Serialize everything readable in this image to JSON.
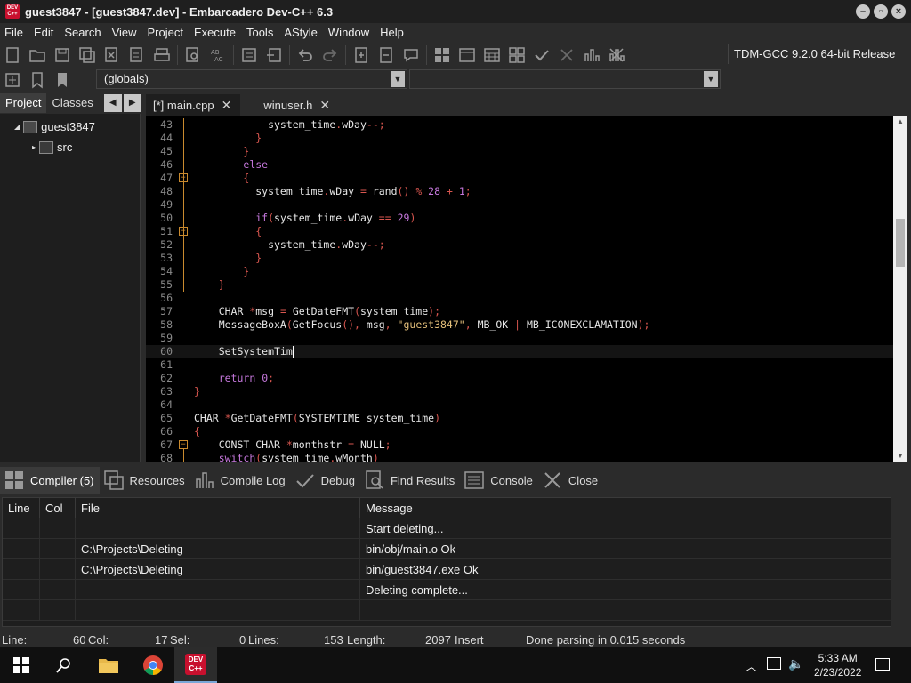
{
  "window": {
    "title": "guest3847 - [guest3847.dev] - Embarcadero Dev-C++ 6.3",
    "icon_label": "DEV C++"
  },
  "menu": [
    "File",
    "Edit",
    "Search",
    "View",
    "Project",
    "Execute",
    "Tools",
    "AStyle",
    "Window",
    "Help"
  ],
  "toolbar": {
    "compiler": "TDM-GCC 9.2.0 64-bit Release",
    "scope_selector": "(globals)",
    "function_selector": ""
  },
  "left_panel": {
    "tabs": [
      "Project",
      "Classes"
    ],
    "tree": [
      {
        "label": "guest3847"
      },
      {
        "label": "src"
      }
    ]
  },
  "editor": {
    "tabs": [
      {
        "label": "[*] main.cpp"
      },
      {
        "label": "winuser.h"
      }
    ],
    "line_numbers": [
      "43",
      "44",
      "45",
      "46",
      "47",
      "48",
      "49",
      "50",
      "51",
      "52",
      "53",
      "54",
      "55",
      "56",
      "57",
      "58",
      "59",
      "60",
      "61",
      "62",
      "63",
      "64",
      "65",
      "66",
      "67",
      "68"
    ],
    "lines": [
      [
        {
          "t": "            system_time",
          "c": "plain"
        },
        {
          "t": ".",
          "c": "op"
        },
        {
          "t": "wDay",
          "c": "plain"
        },
        {
          "t": "--;",
          "c": "op"
        }
      ],
      [
        {
          "t": "          ",
          "c": "plain"
        },
        {
          "t": "}",
          "c": "op"
        }
      ],
      [
        {
          "t": "        ",
          "c": "plain"
        },
        {
          "t": "}",
          "c": "op"
        }
      ],
      [
        {
          "t": "        ",
          "c": "plain"
        },
        {
          "t": "else",
          "c": "kw"
        }
      ],
      [
        {
          "t": "        ",
          "c": "plain"
        },
        {
          "t": "{",
          "c": "op"
        }
      ],
      [
        {
          "t": "          system_time",
          "c": "plain"
        },
        {
          "t": ".",
          "c": "op"
        },
        {
          "t": "wDay ",
          "c": "plain"
        },
        {
          "t": "=",
          "c": "op"
        },
        {
          "t": " rand",
          "c": "plain"
        },
        {
          "t": "()",
          "c": "op"
        },
        {
          "t": " % ",
          "c": "op"
        },
        {
          "t": "28",
          "c": "num"
        },
        {
          "t": " + ",
          "c": "op"
        },
        {
          "t": "1",
          "c": "num"
        },
        {
          "t": ";",
          "c": "op"
        }
      ],
      [
        {
          "t": "",
          "c": "plain"
        }
      ],
      [
        {
          "t": "          ",
          "c": "plain"
        },
        {
          "t": "if",
          "c": "kw"
        },
        {
          "t": "(",
          "c": "op"
        },
        {
          "t": "system_time",
          "c": "plain"
        },
        {
          "t": ".",
          "c": "op"
        },
        {
          "t": "wDay ",
          "c": "plain"
        },
        {
          "t": "==",
          "c": "op"
        },
        {
          "t": " ",
          "c": "plain"
        },
        {
          "t": "29",
          "c": "num"
        },
        {
          "t": ")",
          "c": "op"
        }
      ],
      [
        {
          "t": "          ",
          "c": "plain"
        },
        {
          "t": "{",
          "c": "op"
        }
      ],
      [
        {
          "t": "            system_time",
          "c": "plain"
        },
        {
          "t": ".",
          "c": "op"
        },
        {
          "t": "wDay",
          "c": "plain"
        },
        {
          "t": "--;",
          "c": "op"
        }
      ],
      [
        {
          "t": "          ",
          "c": "plain"
        },
        {
          "t": "}",
          "c": "op"
        }
      ],
      [
        {
          "t": "        ",
          "c": "plain"
        },
        {
          "t": "}",
          "c": "op"
        }
      ],
      [
        {
          "t": "    ",
          "c": "plain"
        },
        {
          "t": "}",
          "c": "op"
        }
      ],
      [
        {
          "t": "",
          "c": "plain"
        }
      ],
      [
        {
          "t": "    CHAR ",
          "c": "plain"
        },
        {
          "t": "*",
          "c": "op"
        },
        {
          "t": "msg ",
          "c": "plain"
        },
        {
          "t": "=",
          "c": "op"
        },
        {
          "t": " GetDateFMT",
          "c": "plain"
        },
        {
          "t": "(",
          "c": "op"
        },
        {
          "t": "system_time",
          "c": "plain"
        },
        {
          "t": ");",
          "c": "op"
        }
      ],
      [
        {
          "t": "    MessageBoxA",
          "c": "plain"
        },
        {
          "t": "(",
          "c": "op"
        },
        {
          "t": "GetFocus",
          "c": "plain"
        },
        {
          "t": "(),",
          "c": "op"
        },
        {
          "t": " msg",
          "c": "plain"
        },
        {
          "t": ",",
          "c": "op"
        },
        {
          "t": " ",
          "c": "plain"
        },
        {
          "t": "\"guest3847\"",
          "c": "str"
        },
        {
          "t": ",",
          "c": "op"
        },
        {
          "t": " MB_OK ",
          "c": "plain"
        },
        {
          "t": "|",
          "c": "op"
        },
        {
          "t": " MB_ICONEXCLAMATION",
          "c": "plain"
        },
        {
          "t": ");",
          "c": "op"
        }
      ],
      [
        {
          "t": "",
          "c": "plain"
        }
      ],
      [
        {
          "t": "    SetSystemTim",
          "c": "plain"
        }
      ],
      [
        {
          "t": "",
          "c": "plain"
        }
      ],
      [
        {
          "t": "    ",
          "c": "plain"
        },
        {
          "t": "return",
          "c": "kw"
        },
        {
          "t": " ",
          "c": "plain"
        },
        {
          "t": "0",
          "c": "num"
        },
        {
          "t": ";",
          "c": "op"
        }
      ],
      [
        {
          "t": "",
          "c": "plain"
        },
        {
          "t": "}",
          "c": "op"
        }
      ],
      [
        {
          "t": "",
          "c": "plain"
        }
      ],
      [
        {
          "t": "CHAR ",
          "c": "plain"
        },
        {
          "t": "*",
          "c": "op"
        },
        {
          "t": "GetDateFMT",
          "c": "plain"
        },
        {
          "t": "(",
          "c": "op"
        },
        {
          "t": "SYSTEMTIME system_time",
          "c": "plain"
        },
        {
          "t": ")",
          "c": "op"
        }
      ],
      [
        {
          "t": "",
          "c": "plain"
        },
        {
          "t": "{",
          "c": "op"
        }
      ],
      [
        {
          "t": "    CONST CHAR ",
          "c": "plain"
        },
        {
          "t": "*",
          "c": "op"
        },
        {
          "t": "monthstr ",
          "c": "plain"
        },
        {
          "t": "=",
          "c": "op"
        },
        {
          "t": " NULL",
          "c": "plain"
        },
        {
          "t": ";",
          "c": "op"
        }
      ],
      [
        {
          "t": "    ",
          "c": "plain"
        },
        {
          "t": "switch",
          "c": "kw"
        },
        {
          "t": "(",
          "c": "op"
        },
        {
          "t": "system_time",
          "c": "plain"
        },
        {
          "t": ".",
          "c": "op"
        },
        {
          "t": "wMonth",
          "c": "plain"
        },
        {
          "t": ")",
          "c": "op"
        }
      ]
    ]
  },
  "bottom_panel": {
    "tabs": [
      {
        "label": "Compiler (5)",
        "icon": "grid-icon"
      },
      {
        "label": "Resources",
        "icon": "resources-icon"
      },
      {
        "label": "Compile Log",
        "icon": "chart-icon"
      },
      {
        "label": "Debug",
        "icon": "check-icon"
      },
      {
        "label": "Find Results",
        "icon": "find-icon"
      },
      {
        "label": "Console",
        "icon": "console-icon"
      },
      {
        "label": "Close",
        "icon": "close-icon"
      }
    ],
    "columns": [
      "Line",
      "Col",
      "File",
      "Message"
    ],
    "rows": [
      [
        "",
        "",
        "",
        "Start deleting..."
      ],
      [
        "",
        "",
        "C:\\Projects\\Deleting",
        "bin/obj/main.o Ok"
      ],
      [
        "",
        "",
        "C:\\Projects\\Deleting",
        "bin/guest3847.exe Ok"
      ],
      [
        "",
        "",
        "",
        "Deleting complete..."
      ],
      [
        "",
        "",
        "",
        ""
      ]
    ]
  },
  "status": {
    "line_label": "Line:",
    "line_value": "60",
    "col_label": "Col:",
    "col_value": "17",
    "sel_label": "Sel:",
    "sel_value": "0",
    "lines_label": "Lines:",
    "lines_value": "153",
    "length_label": "Length:",
    "length_value": "2097",
    "mode": "Insert",
    "message": "Done parsing in 0.015 seconds"
  },
  "taskbar": {
    "time": "5:33 AM",
    "date": "2/23/2022"
  }
}
